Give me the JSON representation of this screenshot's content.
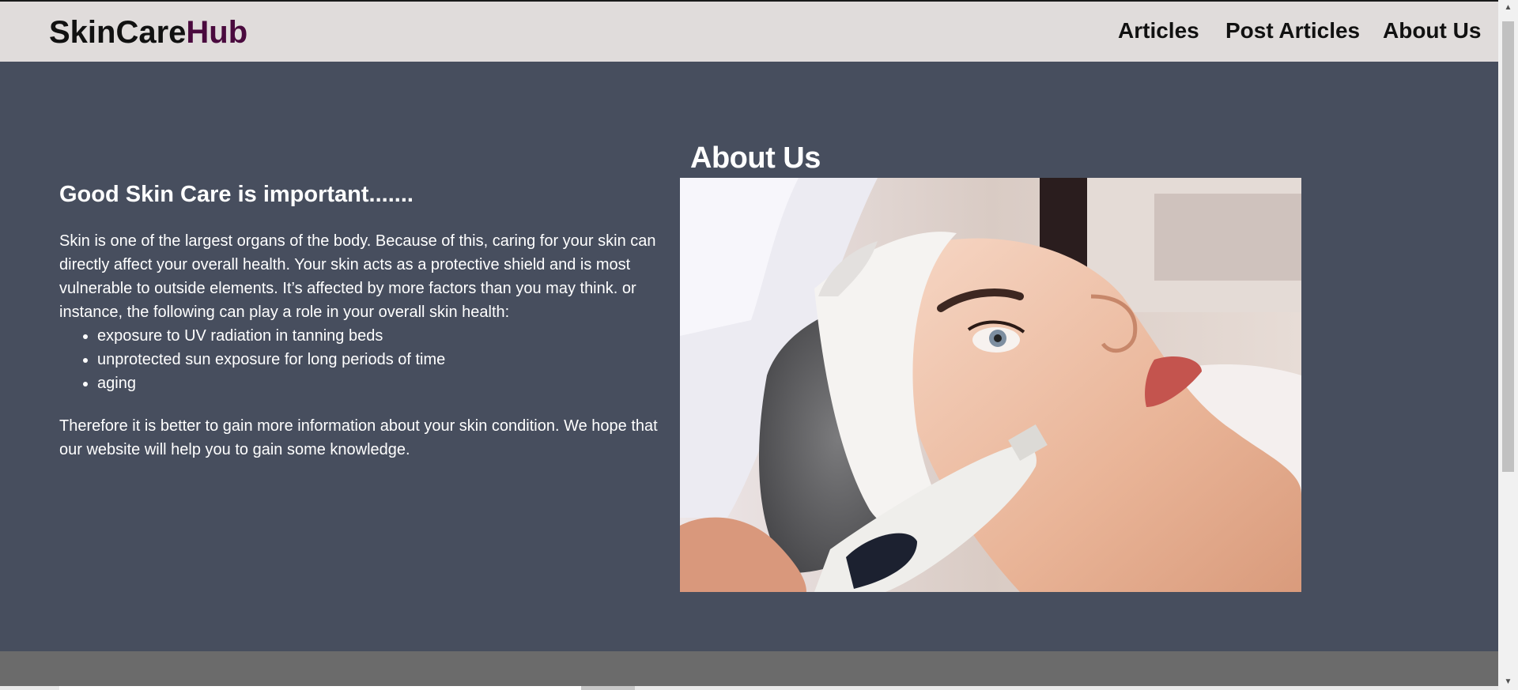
{
  "brand": {
    "part1": "SkinCare",
    "part2": "Hub"
  },
  "nav": {
    "articles": "Articles",
    "post_articles": "Post Articles",
    "about_us": "About Us"
  },
  "main": {
    "title": "About Us",
    "heading": "Good Skin Care is important.......",
    "paragraph1": "Skin is one of the largest organs of the body. Because of this, caring for your skin can directly affect your overall health. Your skin acts as a protective shield and is most vulnerable to outside elements. It’s affected by more factors than you may think. or instance, the following can play a role in your overall skin health:",
    "list": [
      "exposure to UV radiation in tanning beds",
      "unprotected sun exposure for long periods of time",
      "aging"
    ],
    "paragraph2": "Therefore it is better to gain more information about your skin condition. We hope that our website will help you to gain some knowledge."
  },
  "colors": {
    "navbar_bg": "#e0dcdb",
    "brand_accent": "#4a0a3e",
    "main_bg": "#474e5e",
    "footer_bg": "#6b6b6b"
  }
}
